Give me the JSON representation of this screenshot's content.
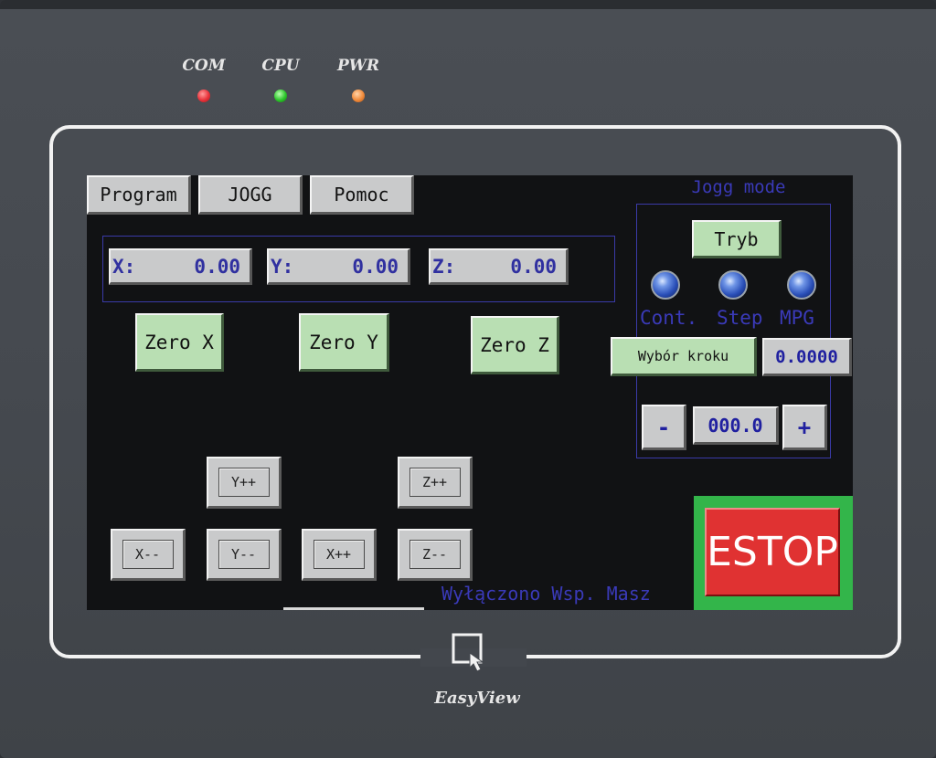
{
  "device": {
    "leds": [
      {
        "label": "COM",
        "color": "#e8323a"
      },
      {
        "label": "CPU",
        "color": "#2cc52a"
      },
      {
        "label": "PWR",
        "color": "#f08a3a"
      }
    ],
    "brand": "EasyView"
  },
  "tabs": {
    "program": "Program",
    "jogg": "JOGG",
    "pomoc": "Pomoc"
  },
  "coords": {
    "x_label": "X:",
    "x_value": "0.00",
    "y_label": "Y:",
    "y_value": "0.00",
    "z_label": "Z:",
    "z_value": "0.00"
  },
  "zero_buttons": {
    "x": "Zero X",
    "y": "Zero Y",
    "z": "Zero Z"
  },
  "jog_buttons": {
    "y_plus": "Y++",
    "z_plus": "Z++",
    "x_minus": "X--",
    "y_minus": "Y--",
    "x_plus": "X++",
    "z_minus": "Z--"
  },
  "jogg_panel": {
    "title": "Jogg mode",
    "tryb": "Tryb",
    "modes": [
      "Cont.",
      "Step",
      "MPG"
    ],
    "step_select_label": "Wybór kroku",
    "step_value": "0.0000",
    "minus": "-",
    "feed_value": "000.0",
    "plus": "+"
  },
  "estop": "ESTOP",
  "status": "Wyłączono Wsp. Masz",
  "colors": {
    "screen_bg": "#111214",
    "accent_blue": "#3a3ab8",
    "button_green": "#b9dfb3",
    "estop_red": "#e03232",
    "estop_frame": "#33b54a"
  }
}
